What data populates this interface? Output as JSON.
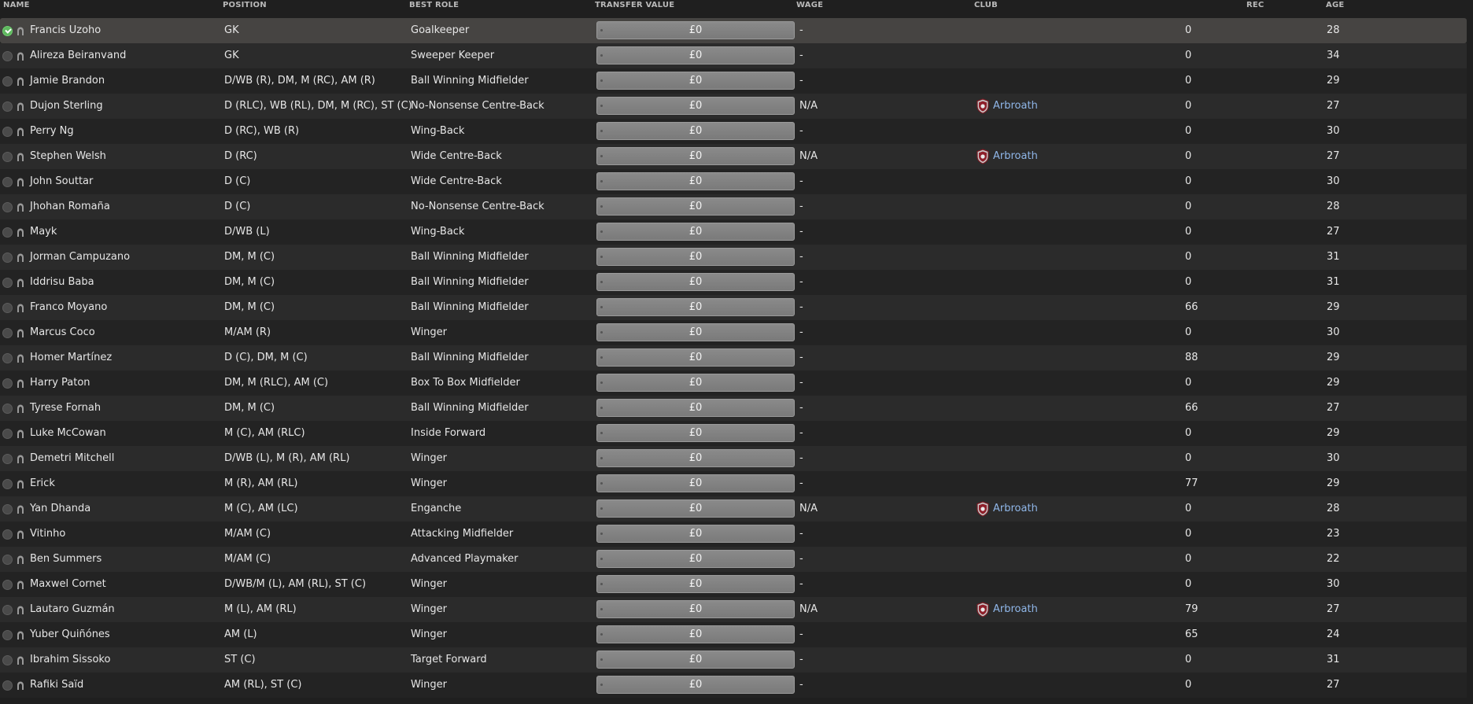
{
  "columns": {
    "name": "NAME",
    "position": "POSITION",
    "best_role": "BEST ROLE",
    "transfer_value": "TRANSFER VALUE",
    "wage": "WAGE",
    "club": "CLUB",
    "rec": "REC",
    "age": "AGE"
  },
  "colors": {
    "accent_link": "#8fb6e8",
    "selected_row": "#464442",
    "check_on": "#5fb75f"
  },
  "players": [
    {
      "name": "Francis Uzoho",
      "position": "GK",
      "role": "Goalkeeper",
      "value": "£0",
      "wage": "-",
      "club": "",
      "rec": "0",
      "age": "28"
    },
    {
      "name": "Alireza Beiranvand",
      "position": "GK",
      "role": "Sweeper Keeper",
      "value": "£0",
      "wage": "-",
      "club": "",
      "rec": "0",
      "age": "34"
    },
    {
      "name": "Jamie Brandon",
      "position": "D/WB (R), DM, M (RC), AM (R)",
      "role": "Ball Winning Midfielder",
      "value": "£0",
      "wage": "-",
      "club": "",
      "rec": "0",
      "age": "29"
    },
    {
      "name": "Dujon Sterling",
      "position": "D (RLC), WB (RL), DM, M (RC), ST (C)",
      "role": "No-Nonsense Centre-Back",
      "value": "£0",
      "wage": "N/A",
      "club": "Arbroath",
      "rec": "0",
      "age": "27"
    },
    {
      "name": "Perry Ng",
      "position": "D (RC), WB (R)",
      "role": "Wing-Back",
      "value": "£0",
      "wage": "-",
      "club": "",
      "rec": "0",
      "age": "30"
    },
    {
      "name": "Stephen Welsh",
      "position": "D (RC)",
      "role": "Wide Centre-Back",
      "value": "£0",
      "wage": "N/A",
      "club": "Arbroath",
      "rec": "0",
      "age": "27"
    },
    {
      "name": "John Souttar",
      "position": "D (C)",
      "role": "Wide Centre-Back",
      "value": "£0",
      "wage": "-",
      "club": "",
      "rec": "0",
      "age": "30"
    },
    {
      "name": "Jhohan Romaña",
      "position": "D (C)",
      "role": "No-Nonsense Centre-Back",
      "value": "£0",
      "wage": "-",
      "club": "",
      "rec": "0",
      "age": "28"
    },
    {
      "name": "Mayk",
      "position": "D/WB (L)",
      "role": "Wing-Back",
      "value": "£0",
      "wage": "-",
      "club": "",
      "rec": "0",
      "age": "27"
    },
    {
      "name": "Jorman Campuzano",
      "position": "DM, M (C)",
      "role": "Ball Winning Midfielder",
      "value": "£0",
      "wage": "-",
      "club": "",
      "rec": "0",
      "age": "31"
    },
    {
      "name": "Iddrisu Baba",
      "position": "DM, M (C)",
      "role": "Ball Winning Midfielder",
      "value": "£0",
      "wage": "-",
      "club": "",
      "rec": "0",
      "age": "31"
    },
    {
      "name": "Franco Moyano",
      "position": "DM, M (C)",
      "role": "Ball Winning Midfielder",
      "value": "£0",
      "wage": "-",
      "club": "",
      "rec": "66",
      "age": "29"
    },
    {
      "name": "Marcus Coco",
      "position": "M/AM (R)",
      "role": "Winger",
      "value": "£0",
      "wage": "-",
      "club": "",
      "rec": "0",
      "age": "30"
    },
    {
      "name": "Homer Martínez",
      "position": "D (C), DM, M (C)",
      "role": "Ball Winning Midfielder",
      "value": "£0",
      "wage": "-",
      "club": "",
      "rec": "88",
      "age": "29"
    },
    {
      "name": "Harry Paton",
      "position": "DM, M (RLC), AM (C)",
      "role": "Box To Box Midfielder",
      "value": "£0",
      "wage": "-",
      "club": "",
      "rec": "0",
      "age": "29"
    },
    {
      "name": "Tyrese Fornah",
      "position": "DM, M (C)",
      "role": "Ball Winning Midfielder",
      "value": "£0",
      "wage": "-",
      "club": "",
      "rec": "66",
      "age": "27"
    },
    {
      "name": "Luke McCowan",
      "position": "M (C), AM (RLC)",
      "role": "Inside Forward",
      "value": "£0",
      "wage": "-",
      "club": "",
      "rec": "0",
      "age": "29"
    },
    {
      "name": "Demetri Mitchell",
      "position": "D/WB (L), M (R), AM (RL)",
      "role": "Winger",
      "value": "£0",
      "wage": "-",
      "club": "",
      "rec": "0",
      "age": "30"
    },
    {
      "name": "Erick",
      "position": "M (R), AM (RL)",
      "role": "Winger",
      "value": "£0",
      "wage": "-",
      "club": "",
      "rec": "77",
      "age": "29"
    },
    {
      "name": "Yan Dhanda",
      "position": "M (C), AM (LC)",
      "role": "Enganche",
      "value": "£0",
      "wage": "N/A",
      "club": "Arbroath",
      "rec": "0",
      "age": "28"
    },
    {
      "name": "Vitinho",
      "position": "M/AM (C)",
      "role": "Attacking Midfielder",
      "value": "£0",
      "wage": "-",
      "club": "",
      "rec": "0",
      "age": "23"
    },
    {
      "name": "Ben Summers",
      "position": "M/AM (C)",
      "role": "Advanced Playmaker",
      "value": "£0",
      "wage": "-",
      "club": "",
      "rec": "0",
      "age": "22"
    },
    {
      "name": "Maxwel Cornet",
      "position": "D/WB/M (L), AM (RL), ST (C)",
      "role": "Winger",
      "value": "£0",
      "wage": "-",
      "club": "",
      "rec": "0",
      "age": "30"
    },
    {
      "name": "Lautaro Guzmán",
      "position": "M (L), AM (RL)",
      "role": "Winger",
      "value": "£0",
      "wage": "N/A",
      "club": "Arbroath",
      "rec": "79",
      "age": "27"
    },
    {
      "name": "Yuber Quiñónes",
      "position": "AM (L)",
      "role": "Winger",
      "value": "£0",
      "wage": "-",
      "club": "",
      "rec": "65",
      "age": "24"
    },
    {
      "name": "Ibrahim Sissoko",
      "position": "ST (C)",
      "role": "Target Forward",
      "value": "£0",
      "wage": "-",
      "club": "",
      "rec": "0",
      "age": "31"
    },
    {
      "name": "Rafiki Saïd",
      "position": "AM (RL), ST (C)",
      "role": "Winger",
      "value": "£0",
      "wage": "-",
      "club": "",
      "rec": "0",
      "age": "27"
    }
  ]
}
